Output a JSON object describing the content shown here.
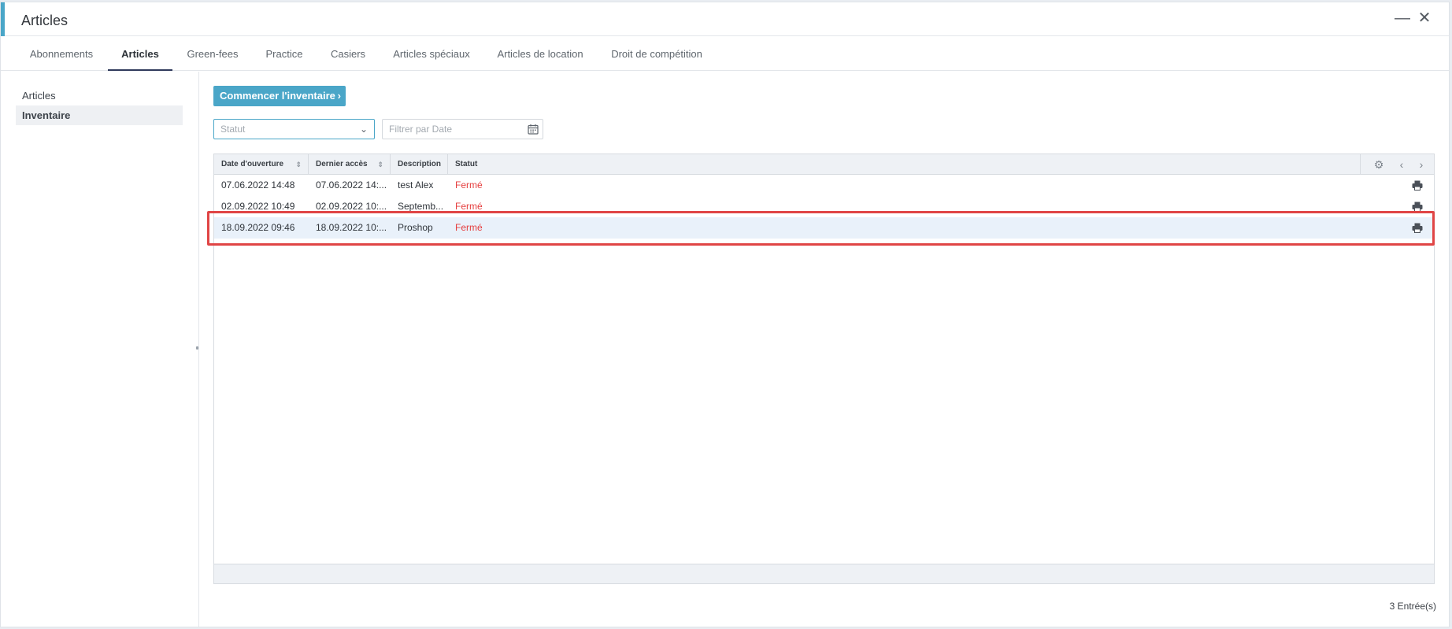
{
  "window": {
    "title": "Articles"
  },
  "tabs": [
    {
      "label": "Abonnements"
    },
    {
      "label": "Articles"
    },
    {
      "label": "Green-fees"
    },
    {
      "label": "Practice"
    },
    {
      "label": "Casiers"
    },
    {
      "label": "Articles spéciaux"
    },
    {
      "label": "Articles de location"
    },
    {
      "label": "Droit de compétition"
    }
  ],
  "active_tab": "Articles",
  "sidebar": {
    "items": [
      {
        "label": "Articles"
      },
      {
        "label": "Inventaire"
      }
    ],
    "active": "Inventaire"
  },
  "toolbar": {
    "start_inventory_label": "Commencer l'inventaire"
  },
  "filters": {
    "status_placeholder": "Statut",
    "date_placeholder": "Filtrer par Date"
  },
  "table": {
    "columns": [
      "Date d'ouverture",
      "Dernier accès",
      "Description",
      "Statut"
    ],
    "rows": [
      {
        "opened": "07.06.2022 14:48",
        "last_access": "07.06.2022 14:...",
        "description": "test Alex",
        "status": "Fermé"
      },
      {
        "opened": "02.09.2022 10:49",
        "last_access": "02.09.2022 10:...",
        "description": "Septemb...",
        "status": "Fermé"
      },
      {
        "opened": "18.09.2022 09:46",
        "last_access": "18.09.2022 10:...",
        "description": "Proshop",
        "status": "Fermé"
      }
    ],
    "selected_row": 2
  },
  "footer": {
    "count_label": "3 Entrée(s)"
  },
  "colors": {
    "accent": "#4aa6c8",
    "status_closed": "#e53e3e",
    "highlight_border": "#e04545"
  }
}
